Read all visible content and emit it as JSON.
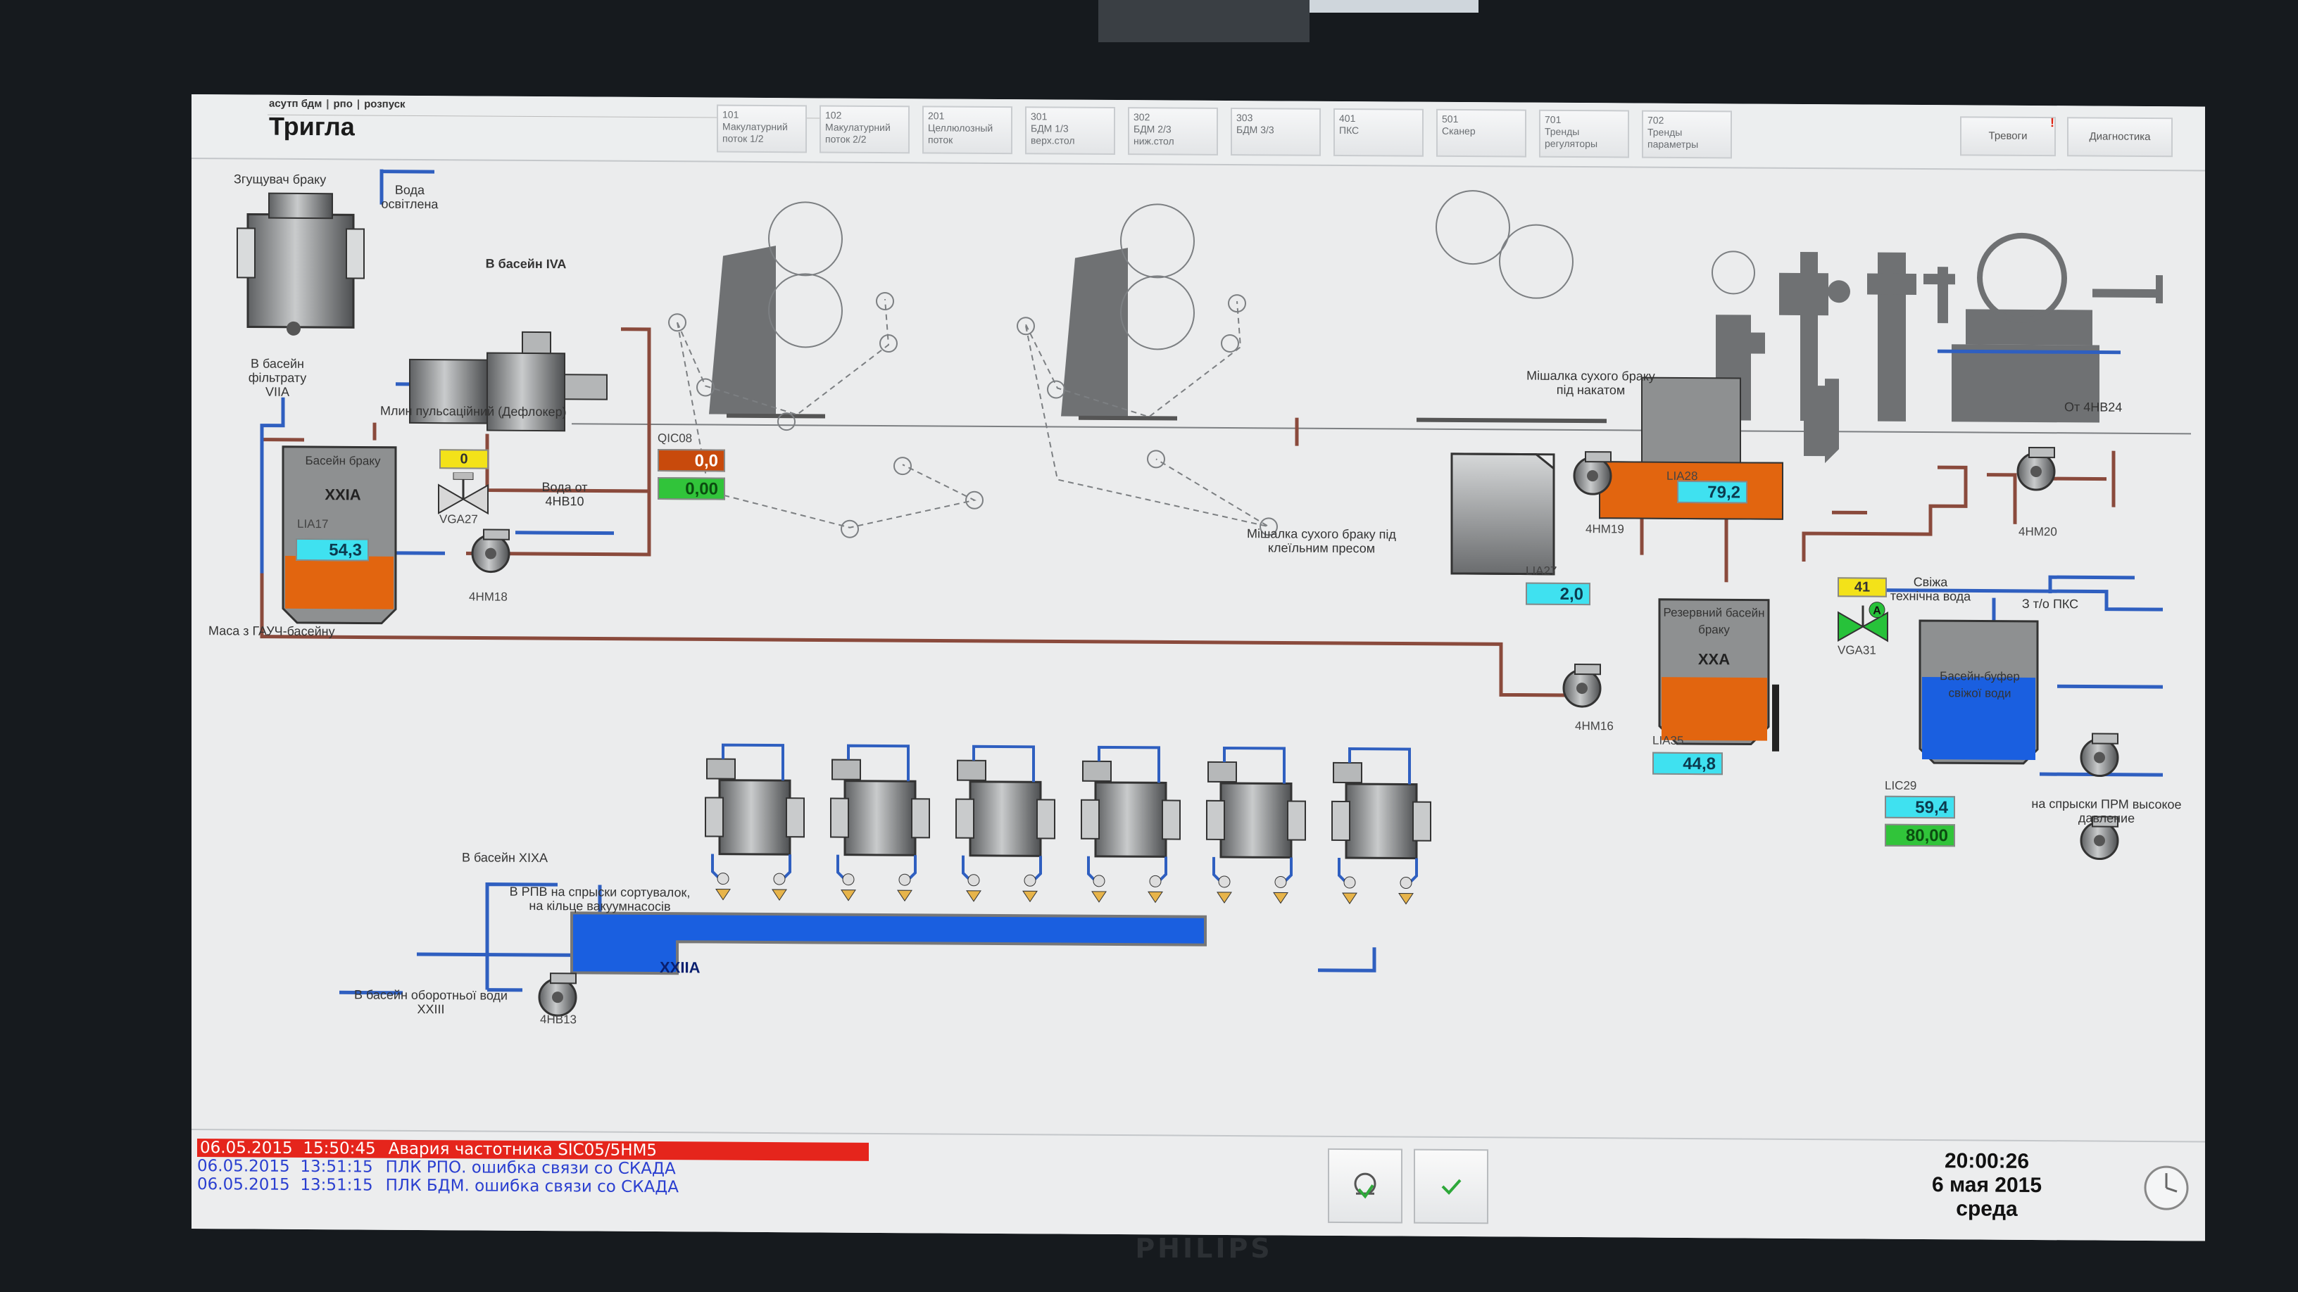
{
  "monitor": {
    "brand": "PHILIPS"
  },
  "header": {
    "breadcrumbs": [
      "асутп бдм",
      "рпо",
      "розпуск"
    ],
    "title": "Тригла",
    "tabs": [
      {
        "num": "101",
        "label": "Макулатурний поток 1/2"
      },
      {
        "num": "102",
        "label": "Макулатурний поток 2/2"
      },
      {
        "num": "201",
        "label": "Целлюлозный поток"
      },
      {
        "num": "301",
        "label": "БДМ 1/3 верх.стол"
      },
      {
        "num": "302",
        "label": "БДМ 2/3 ниж.стол"
      },
      {
        "num": "303",
        "label": "БДМ 3/3"
      },
      {
        "num": "401",
        "label": "ПКС"
      },
      {
        "num": "501",
        "label": "Сканер"
      },
      {
        "num": "701",
        "label": "Тренды регуляторы"
      },
      {
        "num": "702",
        "label": "Тренды параметры"
      }
    ],
    "alarms_button": "Тревоги",
    "alarms_mark": "!",
    "diagnostics_button": "Диагностика"
  },
  "labels": {
    "thickener": "Згущувач браку",
    "clarified_water": "Вода освітлена",
    "to_filtrate_basin": "В басейн фільтрату VIIA",
    "to_basin_iva": "В басейн IVA",
    "pulsation_mill": "Млин пульсаційний (Дефлокер)",
    "water_from": "Вода от 4НВ10",
    "mass_from_couch": "Маса з ГАУЧ-басейну",
    "dry_broke_press": "Мішалка сухого браку під клеїльним пресом",
    "dry_broke_reel": "Мішалка сухого браку під накатом",
    "from_4nv24": "От 4НВ24",
    "fresh_water": "Свіжа технічна вода",
    "from_pks": "З т/о ПКС",
    "to_sprays": "на спрыски ПРМ высокое давление",
    "to_basin_xixa": "В басейн XIXA",
    "to_rpv": "В РПВ на спрыски сортувалок, на кільце вакуумнасосів",
    "to_recycle_basin": "В басейн оборотньої води XXIII"
  },
  "tanks": {
    "xxia": {
      "title": "Басейн браку",
      "name": "XXIA"
    },
    "xxa": {
      "title": "Резервний басейн браку",
      "name": "XXA"
    },
    "buffer": {
      "title": "Басейн-буфер свіжої води"
    },
    "xxiia": {
      "name": "XXIIA"
    }
  },
  "tags": {
    "lia17": "LIA17",
    "lia27": "LIA27",
    "lia28": "LIA28",
    "lia35": "LIA35",
    "lic29": "LIC29",
    "qic08": "QIC08",
    "vga27": "VGA27",
    "vga31": "VGA31",
    "4hm18": "4НМ18",
    "4hm19": "4НМ19",
    "4hm20": "4НМ20",
    "4hm16": "4НМ16",
    "4hb13": "4НВ13",
    "valve_mode": "A"
  },
  "values": {
    "lia17": "54,3",
    "lia27": "2,0",
    "lia28": "79,2",
    "lia35": "44,8",
    "lic29_pv": "59,4",
    "lic29_sp": "80,00",
    "qic08_pv": "0,0",
    "qic08_sp": "0,00",
    "vga27_pos": "0",
    "vga31_pos": "41"
  },
  "levels": {
    "lia17": 0.543,
    "lia28": 0.792,
    "lia35": 0.448,
    "lic29": 0.594,
    "lia27": 0.02
  },
  "alarms": [
    {
      "date": "06.05.2015",
      "time": "15:50:45",
      "message": "Авария частотника SIC05/5HM5",
      "active": true
    },
    {
      "date": "06.05.2015",
      "time": "13:51:15",
      "message": "ПЛК РПО. ошибка связи со СКАДА",
      "active": false
    },
    {
      "date": "06.05.2015",
      "time": "13:51:15",
      "message": "ПЛК БДМ. ошибка связи со СКАДА",
      "active": false
    }
  ],
  "clock": {
    "time": "20:00:26",
    "date": "6 мая 2015",
    "day": "среда"
  },
  "colors": {
    "broke_pipe": "#8a4a3c",
    "water_pipe": "#2f5fc0",
    "stock_fill": "#e2650f",
    "water_fill": "#1a5fe0",
    "tank_gray": "#8e9091",
    "alarm_red": "#e5251c"
  }
}
